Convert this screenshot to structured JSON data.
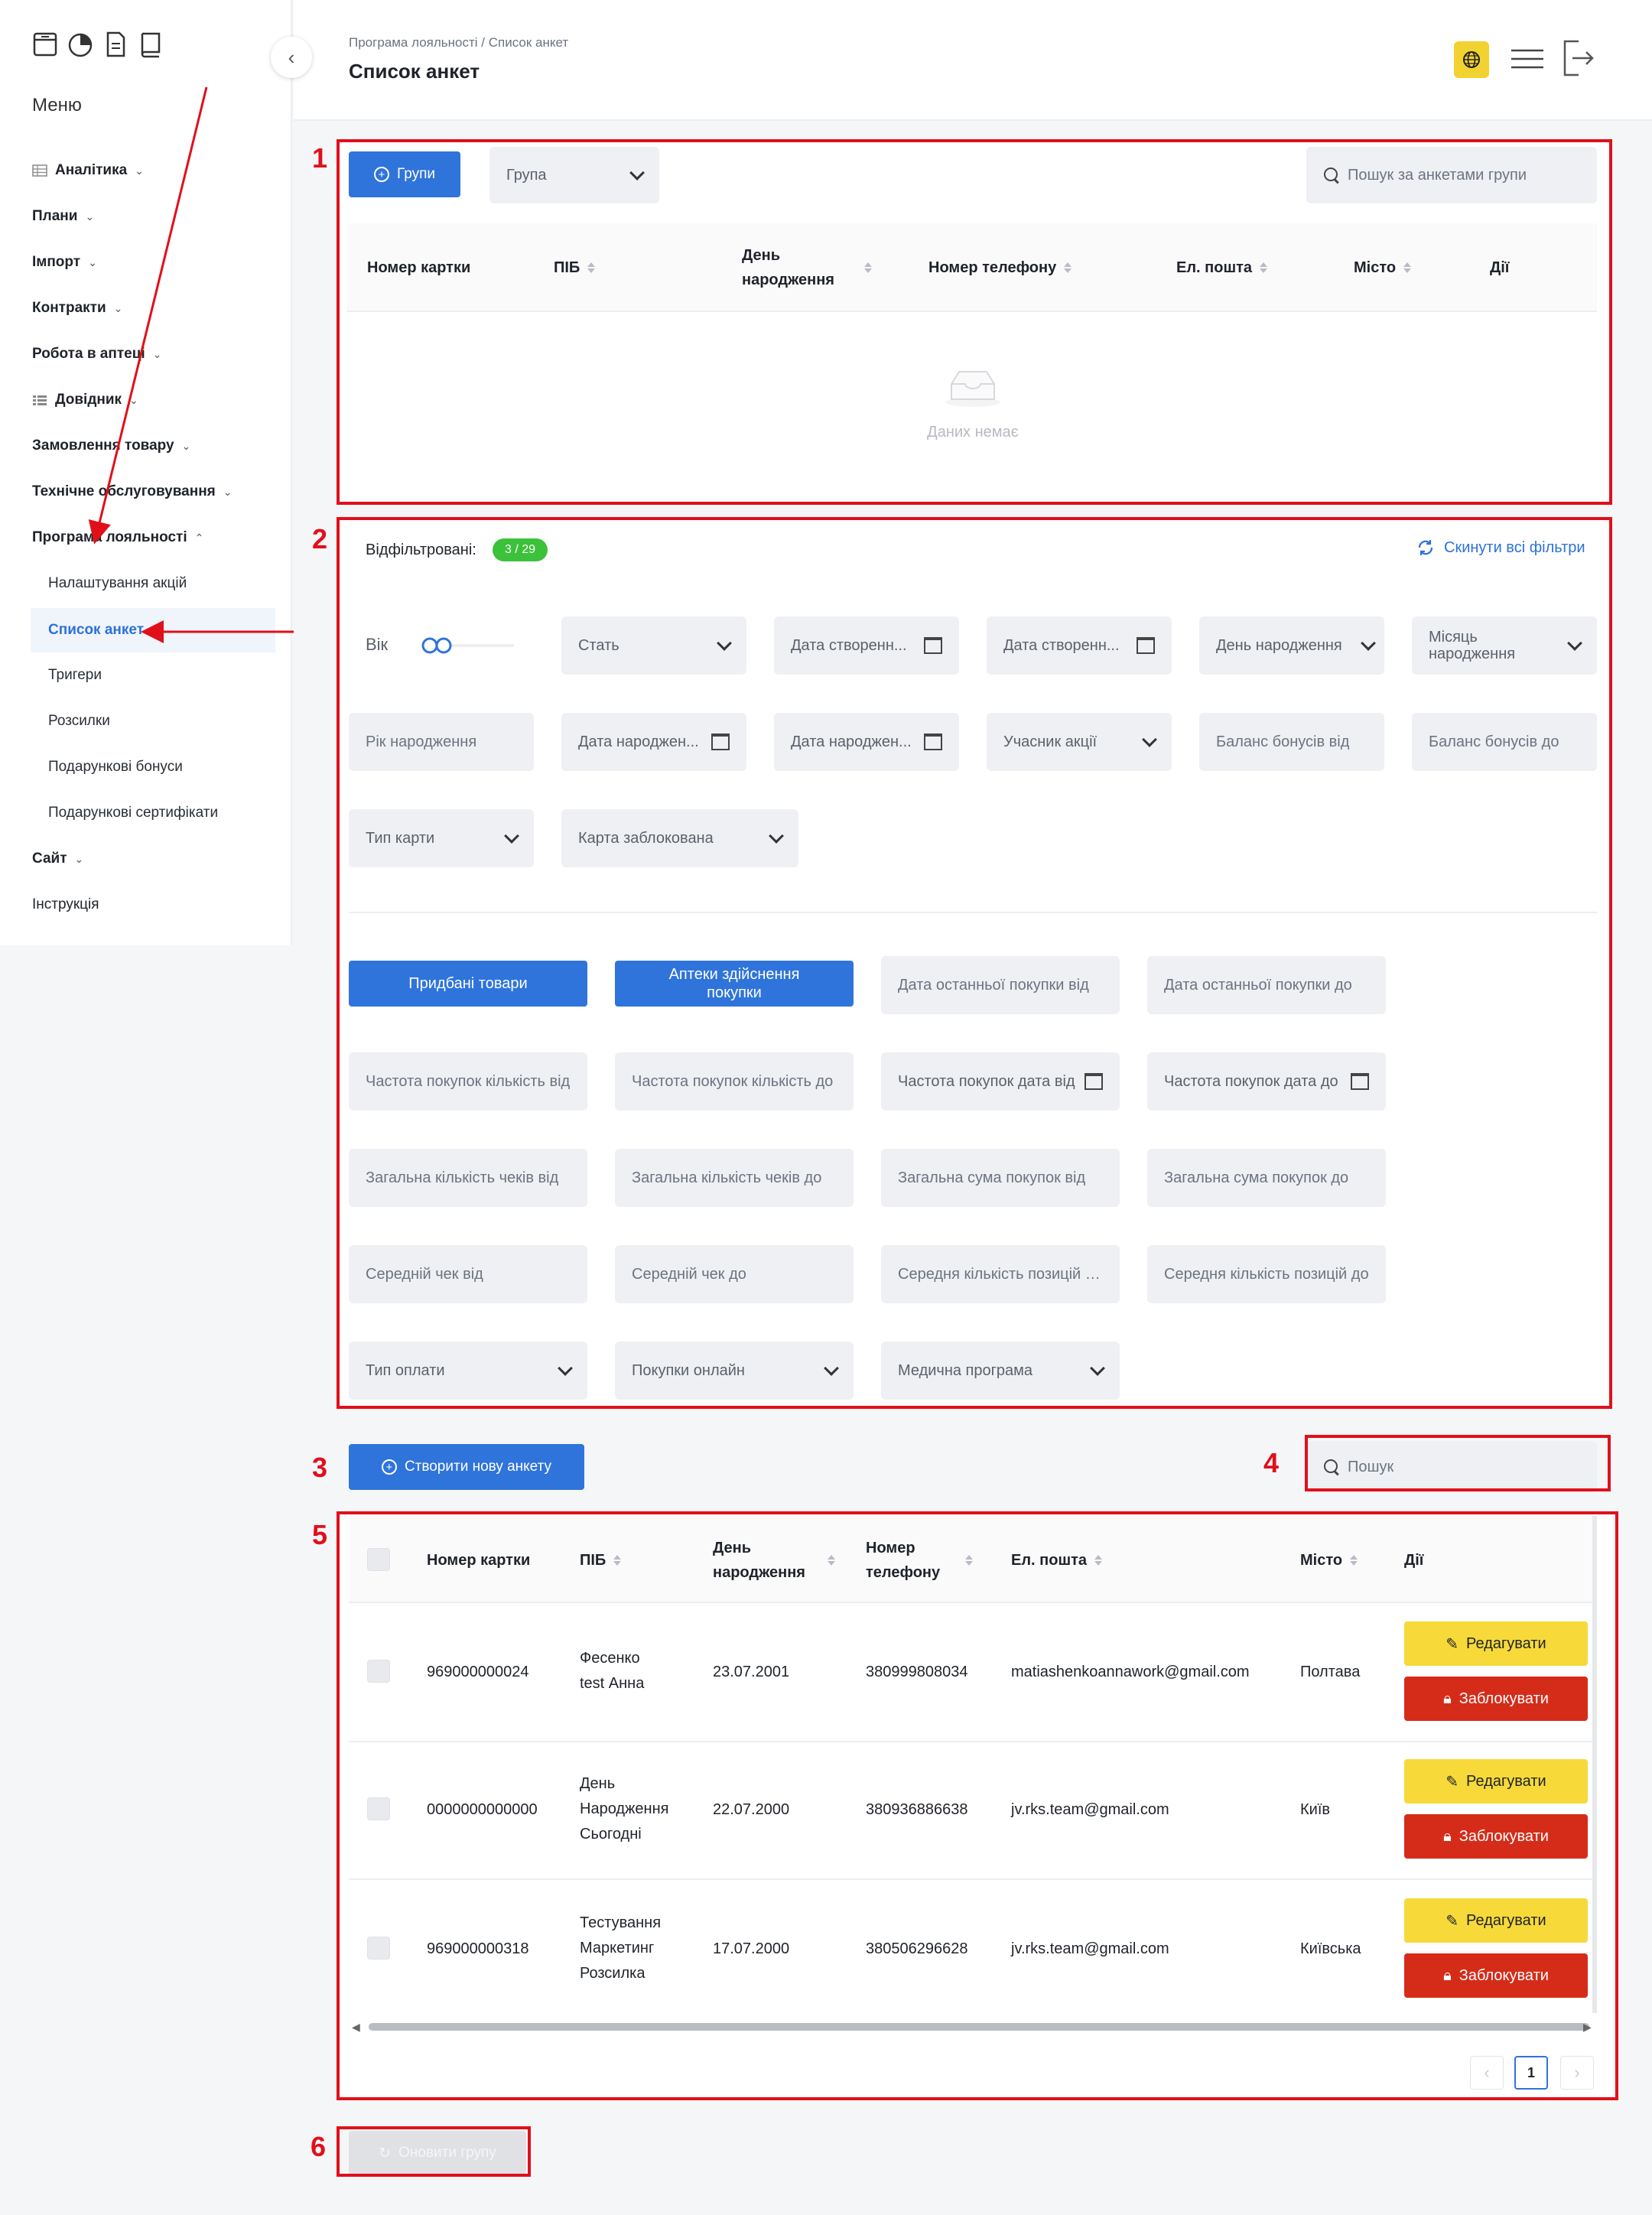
{
  "sidebar": {
    "menu_title": "Меню",
    "items": [
      {
        "label": "Аналітика",
        "icon": "table-icon"
      },
      {
        "label": "Плани"
      },
      {
        "label": "Імпорт"
      },
      {
        "label": "Контракти"
      },
      {
        "label": "Робота в аптеці"
      },
      {
        "label": "Довідник",
        "icon": "list-icon"
      },
      {
        "label": "Замовлення товару"
      },
      {
        "label": "Технічне обслуговування"
      },
      {
        "label": "Програма лояльності"
      },
      {
        "label": "Сайт"
      },
      {
        "label": "Інструкція"
      }
    ],
    "subitems": [
      {
        "label": "Налаштування акцій"
      },
      {
        "label": "Список анкет",
        "active": true
      },
      {
        "label": "Тригери"
      },
      {
        "label": "Розсилки"
      },
      {
        "label": "Подарункові бонуси"
      },
      {
        "label": "Подарункові сертифікати"
      }
    ]
  },
  "header": {
    "breadcrumb": "Програма лояльності / Список анкет",
    "title": "Список анкет"
  },
  "groups": {
    "groups_button": "Групи",
    "group_select": "Група",
    "search_placeholder": "Пошук за анкетами групи",
    "columns": [
      "Номер картки",
      "ПІБ",
      "День народження",
      "Номер телефону",
      "Ел. пошта",
      "Місто",
      "Дії"
    ],
    "empty_text": "Даних немає"
  },
  "filters": {
    "label": "Відфільтровані:",
    "badge": "3 / 29",
    "reset": "Скинути всі фільтри",
    "age": "Вік",
    "fields": {
      "gender": "Стать",
      "created_from": "Дата створенн...",
      "created_to": "Дата створенн...",
      "birthday": "День народження",
      "birth_month": "Місяць народження",
      "birth_year": "Рік народження",
      "birth_date_from": "Дата народжен...",
      "birth_date_to": "Дата народжен...",
      "promo_participant": "Учасник акції",
      "bonus_from": "Баланс бонусів від",
      "bonus_to": "Баланс бонусів до",
      "card_type": "Тип карти",
      "card_blocked": "Карта заблокована",
      "bought_goods": "Придбані товари",
      "pharmacies": "Аптеки здійснення покупки",
      "last_purchase_from": "Дата останньої покупки від",
      "last_purchase_to": "Дата останньої покупки до",
      "freq_count_from": "Частота покупок кількість від",
      "freq_count_to": "Частота покупок кількість до",
      "freq_date_from": "Частота покупок дата від",
      "freq_date_to": "Частота покупок дата до",
      "checks_from": "Загальна кількість чеків від",
      "checks_to": "Загальна кількість чеків до",
      "sum_from": "Загальна сума покупок від",
      "sum_to": "Загальна сума покупок до",
      "avg_check_from": "Середній чек від",
      "avg_check_to": "Середній чек до",
      "avg_items_from": "Середня кількість позицій від",
      "avg_items_to": "Середня кількість позицій до",
      "payment_type": "Тип оплати",
      "online": "Покупки онлайн",
      "medical": "Медична програма"
    }
  },
  "main": {
    "create_button": "Створити нову анкету",
    "search_placeholder": "Пошук",
    "columns": [
      "Номер картки",
      "ПІБ",
      "День народження",
      "Номер телефону",
      "Ел. пошта",
      "Місто",
      "Дії"
    ],
    "rows": [
      {
        "card": "969000000024",
        "name": [
          "Фесенко",
          "test Анна"
        ],
        "birthday": "23.07.2001",
        "phone": "380999808034",
        "email": "matiashenkoannawork@gmail.com",
        "city": "Полтава"
      },
      {
        "card": "0000000000000",
        "name": [
          "День",
          "Народження",
          "Сьогодні"
        ],
        "birthday": "22.07.2000",
        "phone": "380936886638",
        "email": "jv.rks.team@gmail.com",
        "city": "Київ"
      },
      {
        "card": "969000000318",
        "name": [
          "Тестування",
          "Маркетинг",
          "Розсилка"
        ],
        "birthday": "17.07.2000",
        "phone": "380506296628",
        "email": "jv.rks.team@gmail.com",
        "city": "Київська"
      }
    ],
    "edit_label": "Редагувати",
    "block_label": "Заблокувати",
    "page": "1"
  },
  "update_group": "Оновити групу",
  "annotations": [
    "1",
    "2",
    "3",
    "4",
    "5",
    "6"
  ],
  "colors": {
    "primary": "#2f74db",
    "warning": "#f7d93a",
    "danger": "#d52c1a",
    "badge": "#3cc13b",
    "annotation": "#e0101b"
  }
}
